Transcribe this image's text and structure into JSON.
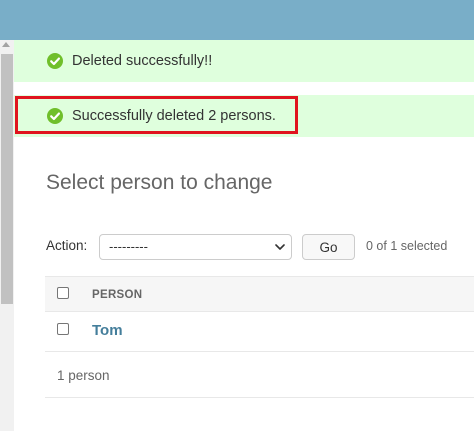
{
  "messages": [
    {
      "text": "Deleted successfully!!"
    },
    {
      "text": "Successfully deleted 2 persons."
    }
  ],
  "page": {
    "title": "Select person to change"
  },
  "actions": {
    "label": "Action:",
    "selected_option": "---------",
    "go_label": "Go",
    "selection_count": "0 of 1 selected"
  },
  "table": {
    "column_header": "PERSON",
    "rows": [
      {
        "name": "Tom"
      }
    ]
  },
  "paginator": {
    "text": "1 person"
  },
  "colors": {
    "header_bar": "#79aec8",
    "message_bg": "#dfffdd",
    "success_icon": "#70bf2b",
    "highlight": "#e0141e",
    "link": "#447e9b"
  },
  "icons": {
    "message": "success-check-icon",
    "select": "chevron-down-icon"
  }
}
